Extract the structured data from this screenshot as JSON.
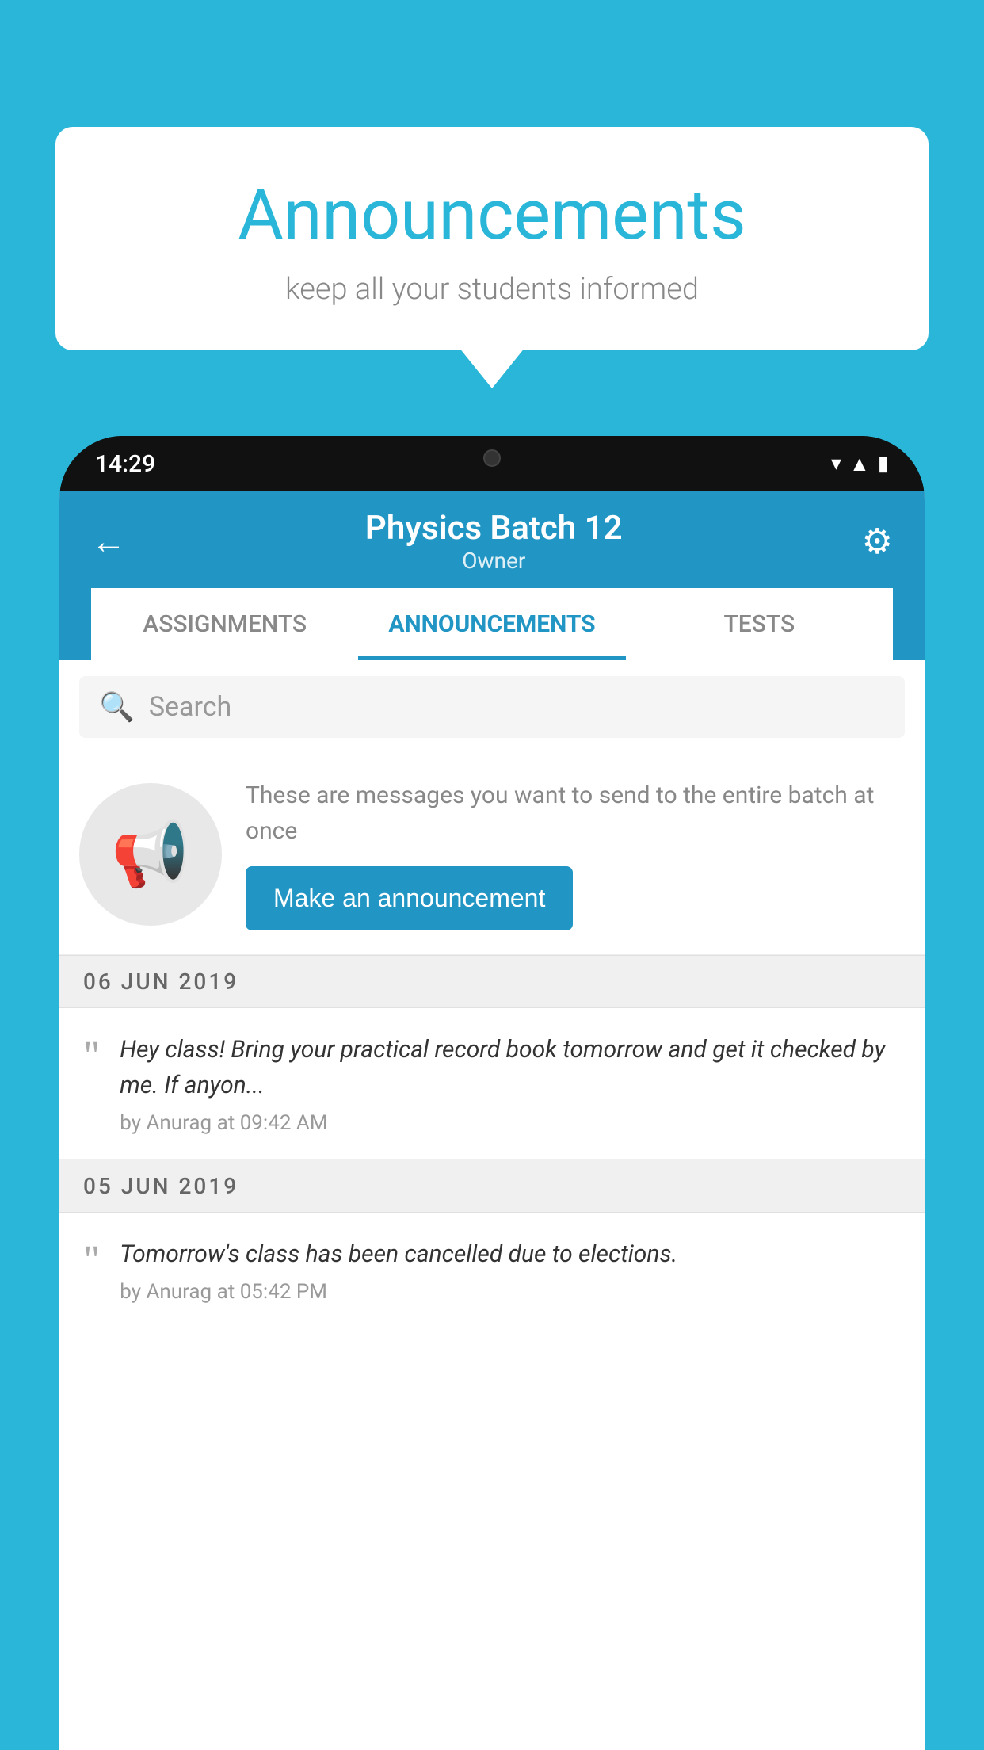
{
  "background_color": "#29b6d8",
  "speech_bubble": {
    "title": "Announcements",
    "subtitle": "keep all your students informed"
  },
  "phone": {
    "status_bar": {
      "time": "14:29"
    },
    "header": {
      "back_label": "←",
      "title": "Physics Batch 12",
      "subtitle": "Owner",
      "gear_label": "⚙"
    },
    "tabs": [
      {
        "label": "ASSIGNMENTS",
        "active": false
      },
      {
        "label": "ANNOUNCEMENTS",
        "active": true
      },
      {
        "label": "TESTS",
        "active": false
      }
    ],
    "search": {
      "placeholder": "Search"
    },
    "promo": {
      "description": "These are messages you want to send to the entire batch at once",
      "button_label": "Make an announcement"
    },
    "announcements": [
      {
        "date": "06  JUN  2019",
        "text": "Hey class! Bring your practical record book tomorrow and get it checked by me. If anyon...",
        "meta": "by Anurag at 09:42 AM"
      },
      {
        "date": "05  JUN  2019",
        "text": "Tomorrow's class has been cancelled due to elections.",
        "meta": "by Anurag at 05:42 PM"
      }
    ]
  }
}
